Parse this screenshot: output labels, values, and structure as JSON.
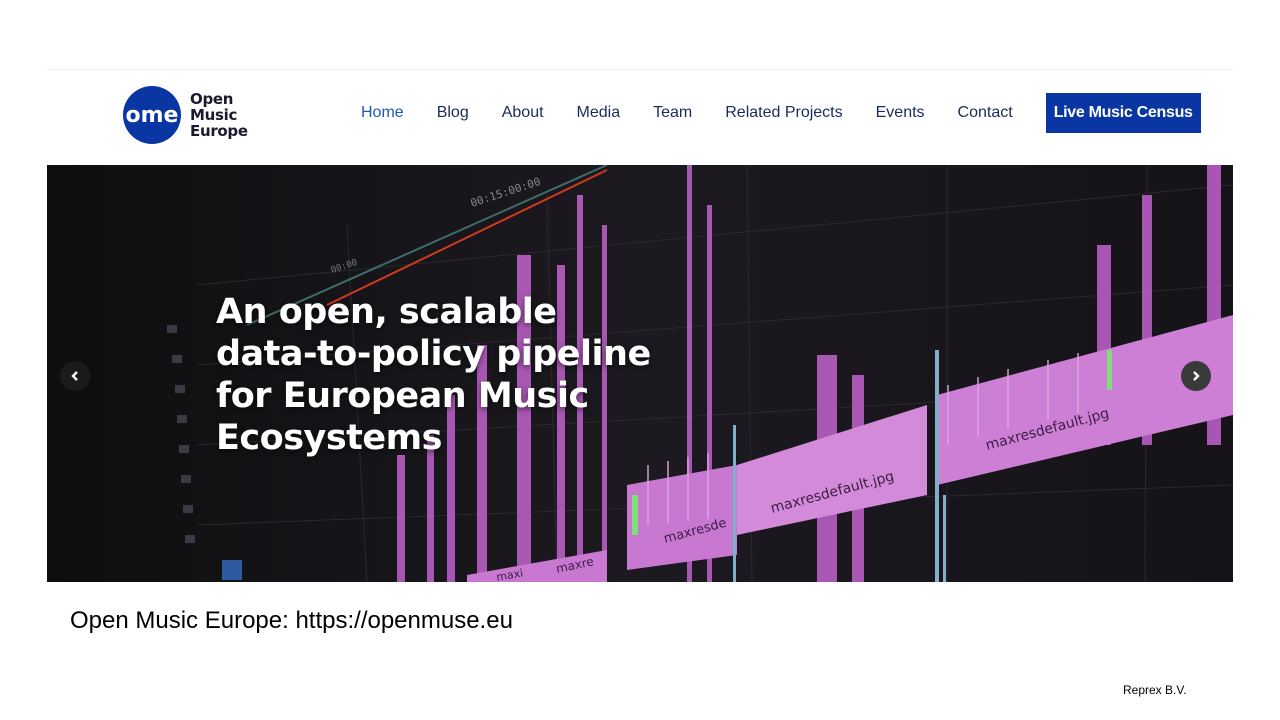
{
  "logo": {
    "mark_text": "ome",
    "lines": [
      "Open",
      "Music",
      "Europe"
    ]
  },
  "nav": {
    "items": [
      "Home",
      "Blog",
      "About",
      "Media",
      "Team",
      "Related Projects",
      "Events",
      "Contact"
    ],
    "cta": "Live Music Census"
  },
  "hero": {
    "title": "An open, scalable data-to-policy pipeline for European Music Ecosystems",
    "timeline_labels": [
      "00:15:00:00",
      "00:00"
    ],
    "clip_labels": [
      "maxresdefault.jpg",
      "maxresdefault.jpg",
      "maxresde",
      "maxre",
      "maxi"
    ]
  },
  "caption": "Open Music Europe: https://openmuse.eu",
  "footer": "Reprex B.V.",
  "colors": {
    "brand_blue": "#0a36a4",
    "nav_text": "#1d2a5c",
    "active": "#2456b8",
    "clip_pink": "#c066c8"
  }
}
